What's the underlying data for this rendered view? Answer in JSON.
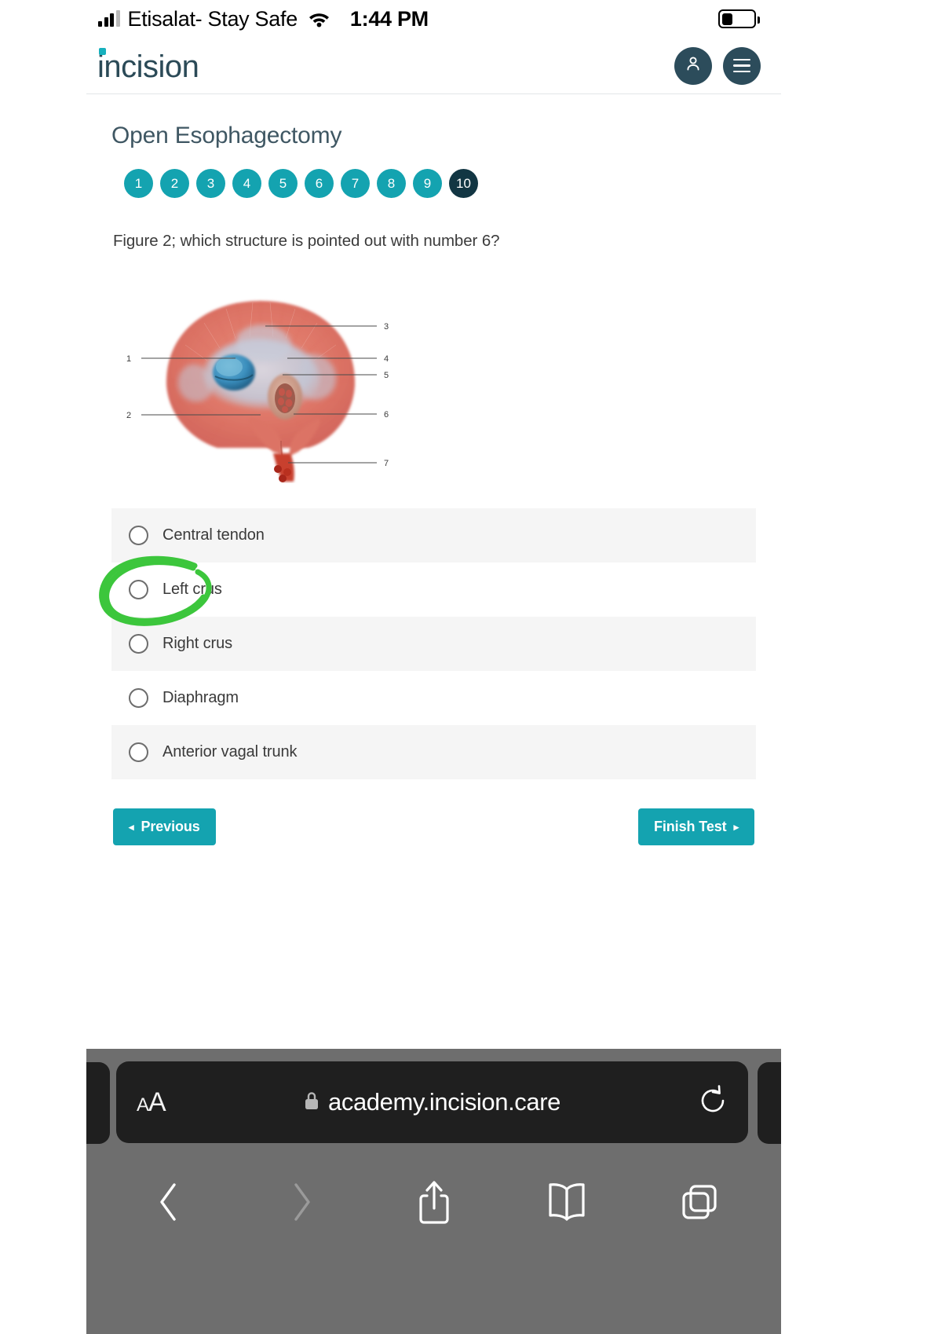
{
  "status_bar": {
    "signal_icon": "signal-bars-icon",
    "carrier": "Etisalat- Stay Safe",
    "wifi_icon": "wifi-icon",
    "time": "1:44 PM",
    "battery_icon": "battery-low-icon"
  },
  "header": {
    "brand": "incision",
    "account_icon": "person-icon",
    "menu_icon": "hamburger-menu-icon"
  },
  "page": {
    "title": "Open Esophagectomy",
    "question": "Figure 2; which structure is pointed out with number 6?"
  },
  "steps": {
    "items": [
      "1",
      "2",
      "3",
      "4",
      "5",
      "6",
      "7",
      "8",
      "9",
      "10"
    ],
    "current": "10",
    "color_active": "#14a3b0",
    "color_current": "#123643"
  },
  "figure": {
    "alt": "Abdominal surface of the diaphragm with numbered leader lines",
    "labels": [
      "1",
      "2",
      "3",
      "4",
      "5",
      "6",
      "7"
    ]
  },
  "options": [
    {
      "label": "Central tendon",
      "selected": false
    },
    {
      "label": "Left crus",
      "selected": false
    },
    {
      "label": "Right crus",
      "selected": false
    },
    {
      "label": "Diaphragm",
      "selected": false
    },
    {
      "label": "Anterior vagal trunk",
      "selected": false
    }
  ],
  "annotation": {
    "type": "hand-drawn-circle",
    "target": "Left crus",
    "color": "#3cc63c"
  },
  "nav": {
    "previous_label": "Previous",
    "previous_caret": "◂",
    "finish_label": "Finish Test",
    "finish_caret": "▸",
    "button_color": "#14a3b0"
  },
  "browser": {
    "text_size_button": "AA",
    "lock_icon": "lock-icon",
    "url": "academy.incision.care",
    "reload_icon": "reload-icon",
    "back_icon": "chevron-left-icon",
    "forward_icon": "chevron-right-icon",
    "share_icon": "share-icon",
    "bookmarks_icon": "book-icon",
    "tabs_icon": "tabs-icon"
  }
}
